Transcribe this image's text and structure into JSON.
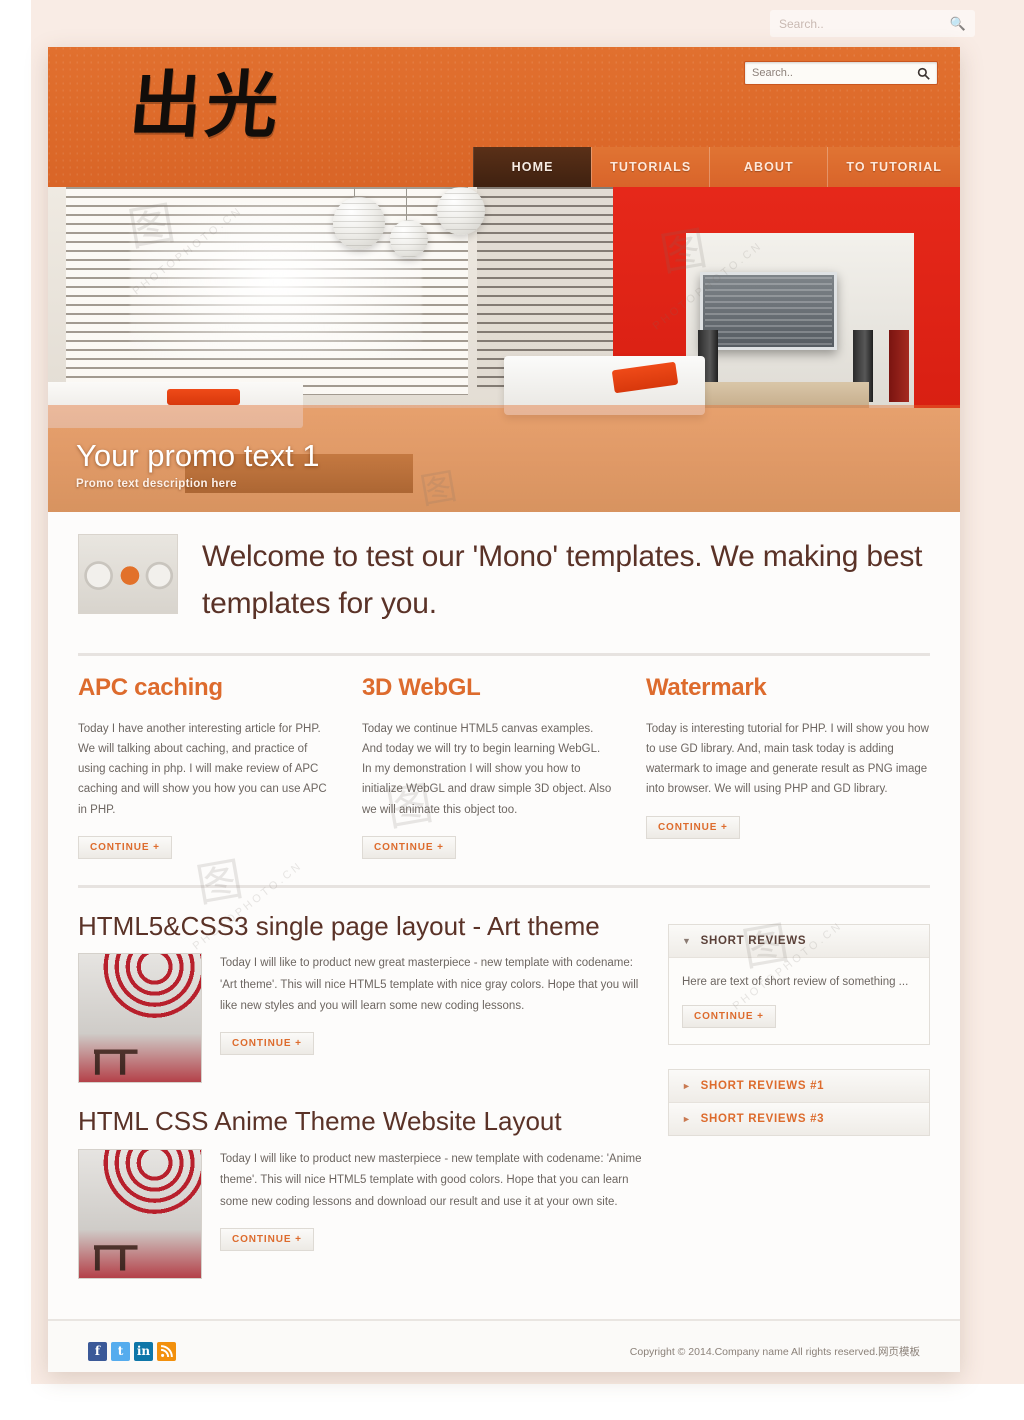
{
  "browser": {
    "ghost_search_placeholder": "Search..",
    "ghost_search_icon": "search-icon"
  },
  "header": {
    "logo_text": "出光",
    "search": {
      "placeholder": "Search..",
      "value": "",
      "icon": "search-icon"
    },
    "nav": [
      {
        "label": "HOME",
        "active": true
      },
      {
        "label": "TUTORIALS",
        "active": false
      },
      {
        "label": "ABOUT",
        "active": false
      },
      {
        "label": "TO TUTORIAL",
        "active": false
      }
    ]
  },
  "hero": {
    "promo_title": "Your promo text 1",
    "promo_subtitle": "Promo text description here"
  },
  "welcome": {
    "thumb_name": "welcome-thumbnail",
    "title": "Welcome to test our 'Mono' templates. We making best templates for you."
  },
  "columns": [
    {
      "title": "APC caching",
      "text": "Today I have another interesting article for PHP. We will talking about caching, and practice of using caching in php. I will make review of APC caching and will show you how you can use APC in PHP.",
      "button": "CONTINUE +"
    },
    {
      "title": "3D WebGL",
      "text": "Today we continue HTML5 canvas examples. And today we will try to begin learning WebGL. In my demonstration I will show you how to initialize WebGL and draw simple 3D object. Also we will animate this object too.",
      "button": "CONTINUE +"
    },
    {
      "title": "Watermark",
      "text": "Today is interesting tutorial for PHP. I will show you how to use GD library. And, main task today is adding watermark to image and generate result as PNG image into browser. We will using PHP and GD library.",
      "button": "CONTINUE +"
    }
  ],
  "articles": [
    {
      "title": "HTML5&CSS3 single page layout - Art theme",
      "text": "Today I will like to product new great masterpiece - new template with codename: 'Art theme'. This will nice HTML5 template with nice gray colors. Hope that you will like new styles and you will learn some new coding lessons.",
      "button": "CONTINUE +",
      "thumb_name": "article-thumbnail"
    },
    {
      "title": "HTML CSS Anime Theme Website Layout",
      "text": "Today I will like to product new masterpiece - new template with codename: 'Anime theme'. This will nice HTML5 template with good colors. Hope that you can learn some new coding lessons and download our result and use it at your own site.",
      "button": "CONTINUE +",
      "thumb_name": "article-thumbnail"
    }
  ],
  "sidebar": {
    "expanded": {
      "title": "SHORT REVIEWS",
      "caret": "▼",
      "text": "Here are text of short review of something ...",
      "button": "CONTINUE +"
    },
    "collapsed": [
      {
        "title": "SHORT REVIEWS #1",
        "caret": "►"
      },
      {
        "title": "SHORT REVIEWS #3",
        "caret": "►"
      }
    ]
  },
  "footer": {
    "social": [
      {
        "name": "facebook-icon",
        "glyph": "f"
      },
      {
        "name": "twitter-icon",
        "glyph": "t"
      },
      {
        "name": "linkedin-icon",
        "glyph": "in"
      },
      {
        "name": "rss-icon",
        "glyph": "◝"
      }
    ],
    "copyright": "Copyright © 2014.Company name All rights reserved.网页模板"
  },
  "colors": {
    "brand_orange": "#dd6b2d",
    "header_orange": "#dd6a2a",
    "nav_active": "#3f2110",
    "heading_brown": "#5a3227",
    "body_text": "#6d6661",
    "page_bg": "#f9ece5"
  },
  "watermarks": [
    "PHOTOPHOTO.CN",
    "PHOTOPHOTO.CN",
    "PHOTOPHOTO.CN",
    "PHOTOPHOTO.CN"
  ]
}
